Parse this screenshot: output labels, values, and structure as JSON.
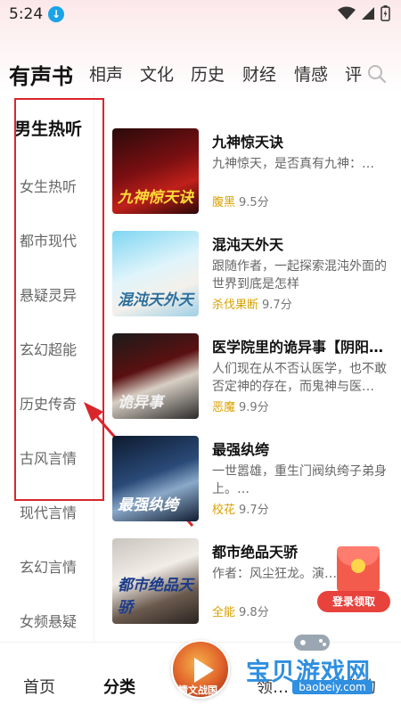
{
  "status": {
    "time": "5:24"
  },
  "top_tabs": [
    "有声书",
    "相声",
    "文化",
    "历史",
    "财经",
    "情感",
    "评"
  ],
  "sidebar": [
    "男生热听",
    "女生热听",
    "都市现代",
    "悬疑灵异",
    "玄幻超能",
    "历史传奇",
    "古风言情",
    "现代言情",
    "玄幻言情",
    "女频悬疑"
  ],
  "books": [
    {
      "title": "九神惊天诀",
      "desc": "九神惊天，是否真有九神：…",
      "author": "腹黑",
      "score": "9.5分",
      "cover_text": "九神惊天诀"
    },
    {
      "title": "混沌天外天",
      "desc": "跟随作者，一起探索混沌外面的世界到底是怎样",
      "author": "杀伐果断",
      "score": "9.7分",
      "cover_text": "混沌天外天"
    },
    {
      "title": "医学院里的诡异事【阴阳…",
      "desc": "人们现在从不否认医学，也不敢否定神的存在，而鬼神与医…",
      "author": "恶魔",
      "score": "9.9分",
      "cover_text": "诡异事"
    },
    {
      "title": "最强纨绔",
      "desc": "一世嚣雄，重生门阀纨绔子弟身上。…",
      "author": "校花",
      "score": "9.7分",
      "cover_text": "最强纨绔"
    },
    {
      "title": "都市绝品天骄",
      "desc": "作者：风尘狂龙。演…狐。…",
      "author": "全能",
      "score": "9.8分",
      "cover_text": "都市绝品天骄"
    }
  ],
  "bottom_nav": {
    "home": "首页",
    "category": "分类",
    "play_text": "情文战国",
    "welfare": "领…",
    "mine": "我的"
  },
  "login_float": "登录领取",
  "watermark": {
    "text": "宝贝游戏网",
    "url": "baobeiy.com"
  },
  "colors": {
    "highlight": "#d9262c",
    "author": "#d9a100",
    "watermark": "#2f8fe0"
  }
}
